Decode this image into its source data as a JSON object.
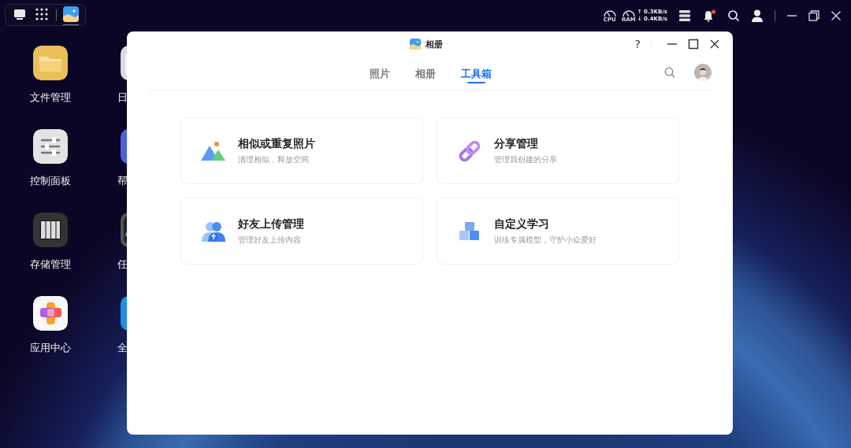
{
  "taskbar": {
    "apps": [
      {
        "kind": "desktop",
        "selected": false
      },
      {
        "kind": "launcher",
        "selected": false
      },
      {
        "kind": "photos",
        "selected": true
      }
    ]
  },
  "tray": {
    "cpu_label": "CPU",
    "ram_label": "RAM",
    "upload": "↑ 0.3KB/s",
    "download": "↓ 0.4KB/s",
    "notification": true
  },
  "desktop_icons": [
    {
      "kind": "folder",
      "label": "文件管理"
    },
    {
      "kind": "control",
      "label": "控制面板"
    },
    {
      "kind": "storage",
      "label": "存储管理"
    },
    {
      "kind": "appcenter",
      "label": "应用中心"
    },
    {
      "kind": "calendar",
      "label": "日"
    },
    {
      "kind": "help",
      "label": "帮"
    },
    {
      "kind": "monitor",
      "label": "任"
    },
    {
      "kind": "blue",
      "label": "全"
    }
  ],
  "window": {
    "title": "相册",
    "help": "?",
    "tabs": [
      {
        "label": "照片",
        "selected": false
      },
      {
        "label": "相册",
        "selected": false
      },
      {
        "label": "工具箱",
        "selected": true
      }
    ],
    "cards": [
      {
        "kind": "photos",
        "title": "相似或重复照片",
        "subtitle": "清理相似，释放空间"
      },
      {
        "kind": "link",
        "title": "分享管理",
        "subtitle": "管理我创建的分享"
      },
      {
        "kind": "upload",
        "title": "好友上传管理",
        "subtitle": "管理好友上传内容"
      },
      {
        "kind": "cubes",
        "title": "自定义学习",
        "subtitle": "训练专属模型，守护小众爱好"
      }
    ]
  }
}
